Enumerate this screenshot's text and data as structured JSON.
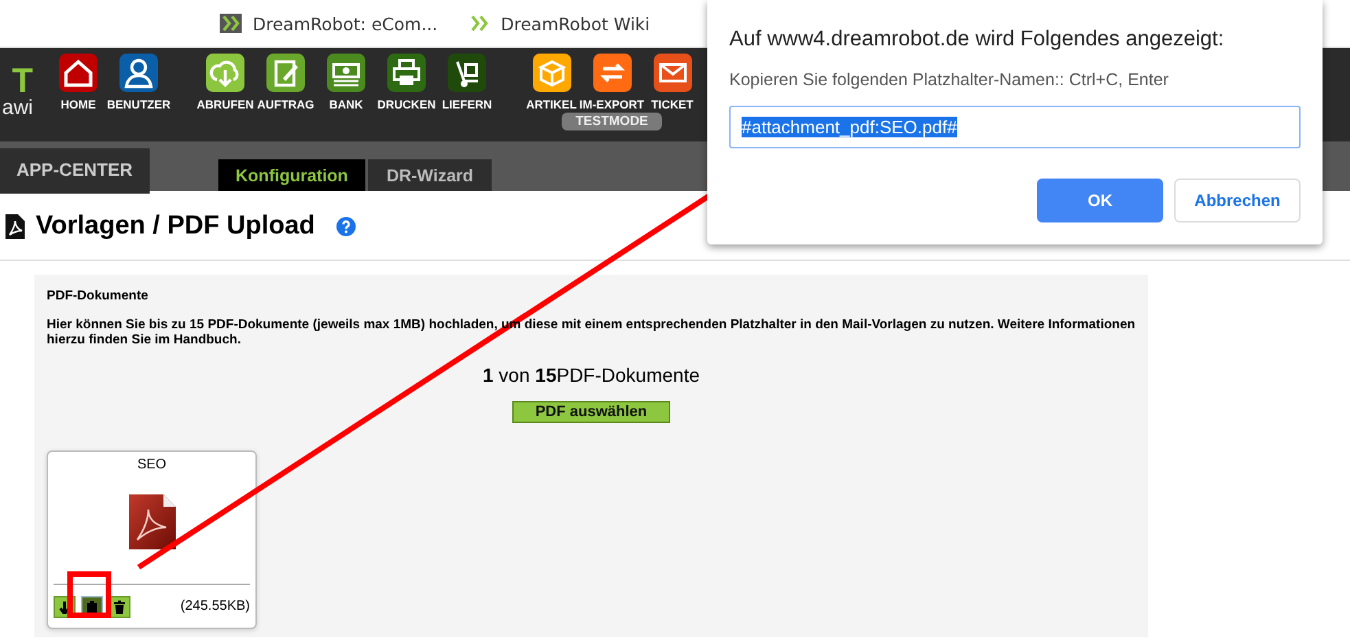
{
  "bookmarks": [
    {
      "label": "DreamRobot: eCom..."
    },
    {
      "label": "DreamRobot Wiki"
    }
  ],
  "logo": {
    "text": "T",
    "subtext": "awi"
  },
  "toolbar": {
    "groups": [
      [
        {
          "label": "HOME",
          "color": "#c00000"
        },
        {
          "label": "BENUTZER",
          "color": "#0b5ea8"
        }
      ],
      [
        {
          "label": "ABRUFEN",
          "color": "#8cc63e"
        },
        {
          "label": "AUFTRAG",
          "color": "#6aa82c"
        },
        {
          "label": "BANK",
          "color": "#4b8a1e"
        },
        {
          "label": "DRUCKEN",
          "color": "#2e6a12"
        },
        {
          "label": "LIEFERN",
          "color": "#1f4a0b"
        }
      ],
      [
        {
          "label": "ARTIKEL",
          "color": "#ffa800"
        },
        {
          "label": "IM-EXPORT",
          "color": "#ff6a13"
        },
        {
          "label": "TICKET",
          "color": "#e8501a"
        }
      ]
    ],
    "badge": "TESTMODE"
  },
  "tabs": {
    "main": "APP-CENTER",
    "sub": [
      {
        "label": "Konfiguration",
        "selected": true
      },
      {
        "label": "DR-Wizard",
        "selected": false
      }
    ]
  },
  "page_title": "Vorlagen / PDF Upload",
  "panel": {
    "heading": "PDF-Dokumente",
    "description": "Hier können Sie bis zu 15 PDF-Dokumente (jeweils max 1MB) hochladen, um diese mit einem entsprechenden Platzhalter in den Mail-Vorlagen zu nutzen. Weitere Informationen hierzu finden Sie im Handbuch.",
    "count": "**1** von **15**PDF-Dokumente",
    "select_button": "PDF auswählen",
    "files": [
      {
        "name": "SEO",
        "size": "(245.55KB)"
      }
    ]
  },
  "dialog": {
    "title": "Auf www4.dreamrobot.de wird Folgendes angezeigt:",
    "message": "Kopieren Sie folgenden Platzhalter-Namen:: Ctrl+C, Enter",
    "value": "#attachment_pdf:SEO.pdf#",
    "buttons": [
      {
        "label": "OK",
        "kind": "primary"
      },
      {
        "label": "Abbrechen",
        "kind": "secondary"
      }
    ]
  }
}
